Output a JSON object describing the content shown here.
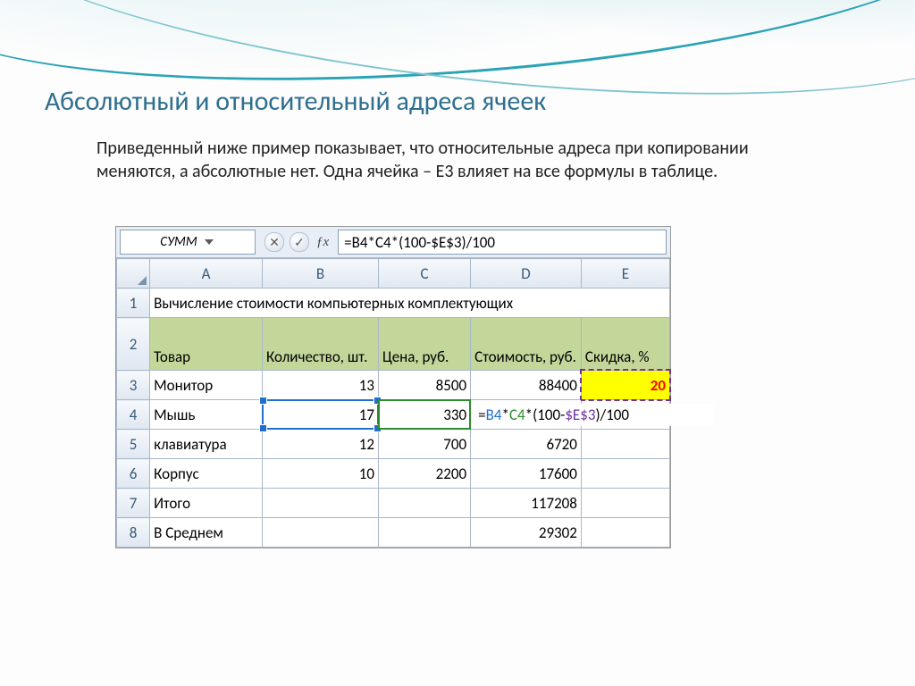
{
  "title": "Абсолютный и относительный адреса ячеек",
  "paragraph": "Приведенный ниже пример показывает, что относительные адреса при копировании меняются, а абсолютные нет. Одна ячейка – E3 влияет на все формулы в таблице.",
  "excel": {
    "name_box": "СУММ",
    "formula_bar": "=B4*C4*(100-$E$3)/100",
    "columns": [
      "A",
      "B",
      "C",
      "D",
      "E"
    ],
    "row_numbers": [
      "1",
      "2",
      "3",
      "4",
      "5",
      "6",
      "7",
      "8"
    ],
    "row1_text": "Вычисление стоимости компьютерных комплектующих",
    "headers2": {
      "A": "Товар",
      "B": "Количество, шт.",
      "C": "Цена, руб.",
      "D": "Стоимость, руб.",
      "E": "Скидка, %"
    },
    "rows": [
      {
        "A": "Монитор",
        "B": "13",
        "C": "8500",
        "D": "88400",
        "E": "20"
      },
      {
        "A": "Мышь",
        "B": "17",
        "C": "330",
        "D_formula_parts": [
          "=",
          "B4",
          "*",
          "C4",
          "*(100-",
          "$E$3",
          ")/100"
        ],
        "E": ""
      },
      {
        "A": "клавиатура",
        "B": "12",
        "C": "700",
        "D": "6720",
        "E": ""
      },
      {
        "A": "Корпус",
        "B": "10",
        "C": "2200",
        "D": "17600",
        "E": ""
      },
      {
        "A": "Итого",
        "B": "",
        "C": "",
        "D": "117208",
        "E": ""
      },
      {
        "A": "В Среднем",
        "B": "",
        "C": "",
        "D": "29302",
        "E": ""
      }
    ],
    "fbar_buttons": {
      "cancel": "✕",
      "enter": "✓"
    }
  },
  "chart_data": {
    "type": "table",
    "title": "Вычисление стоимости компьютерных комплектующих",
    "columns": [
      "Товар",
      "Количество, шт.",
      "Цена, руб.",
      "Стоимость, руб.",
      "Скидка, %"
    ],
    "rows": [
      [
        "Монитор",
        13,
        8500,
        88400,
        20
      ],
      [
        "Мышь",
        17,
        330,
        "=B4*C4*(100-$E$3)/100",
        null
      ],
      [
        "клавиатура",
        12,
        700,
        6720,
        null
      ],
      [
        "Корпус",
        10,
        2200,
        17600,
        null
      ],
      [
        "Итого",
        null,
        null,
        117208,
        null
      ],
      [
        "В Среднем",
        null,
        null,
        29302,
        null
      ]
    ],
    "active_cell": "D4",
    "referenced_cells": [
      "B4",
      "C4",
      "$E$3"
    ]
  }
}
